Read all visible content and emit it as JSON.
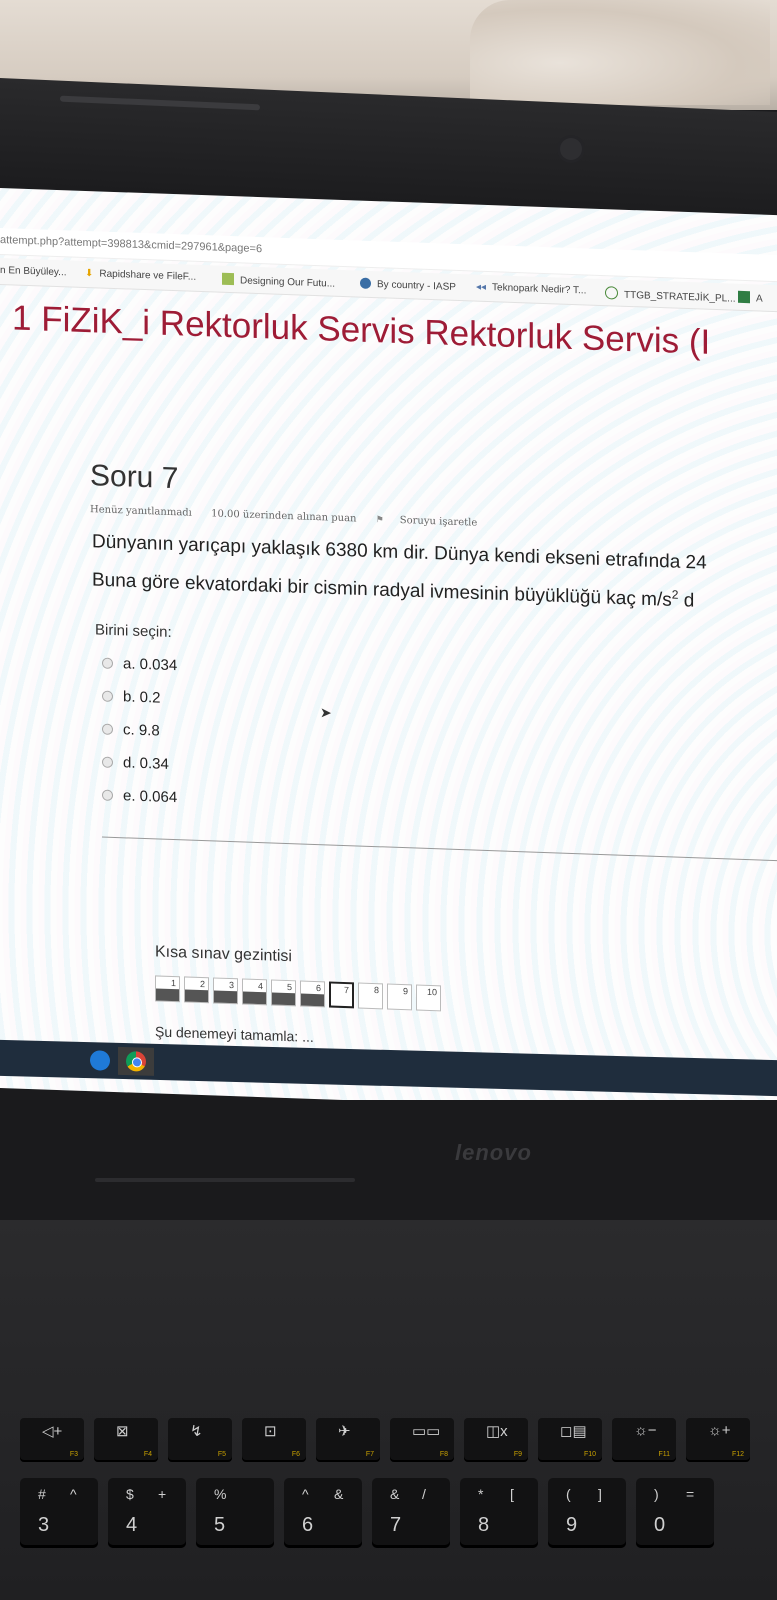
{
  "browser": {
    "url_fragment": "attempt.php?attempt=398813&cmid=297961&page=6",
    "bookmarks": [
      {
        "label": "n En Büyüley...",
        "icon": "none"
      },
      {
        "label": "Rapidshare ve FileF...",
        "icon": "download-icon"
      },
      {
        "label": "Designing Our Futu...",
        "icon": "document-icon"
      },
      {
        "label": "By country - IASP",
        "icon": "globe-icon"
      },
      {
        "label": "Teknopark Nedir? T...",
        "icon": "teknopark-icon"
      },
      {
        "label": "TTGB_STRATEJİK_PL...",
        "icon": "ttgb-icon"
      },
      {
        "label": "A",
        "icon": "green-square-icon"
      }
    ]
  },
  "course": {
    "title": "1 FiZiK_i Rektorluk Servis Rektorluk Servis (I"
  },
  "question": {
    "title": "Soru 7",
    "status": "Henüz yanıtlanmadı",
    "points": "10.00 üzerinden alınan puan",
    "flag_label": "Soruyu işaretle",
    "text_line1": "Dünyanın yarıçapı yaklaşık 6380 km dir. Dünya kendi ekseni etrafında 24",
    "text_line2_pre": "Buna göre ekvatordaki bir cismin radyal ivmesinin büyüklüğü kaç m/s",
    "text_line2_sup": "2",
    "text_line2_post": " d",
    "choose_label": "Birini seçin:",
    "options": [
      "a. 0.034",
      "b. 0.2",
      "c. 9.8",
      "d. 0.34",
      "e. 0.064"
    ]
  },
  "quiz_nav": {
    "title": "Kısa sınav gezintisi",
    "pages": [
      "1",
      "2",
      "3",
      "4",
      "5",
      "6",
      "7",
      "8",
      "9",
      "10"
    ],
    "answered_count": 6,
    "current_page": "7",
    "finish_label": "Şu denemeyi tamamla: ..."
  },
  "taskbar": {
    "apps": [
      "edge-icon",
      "chrome-icon"
    ]
  },
  "laptop": {
    "brand": "lenovo",
    "fn_keys": [
      {
        "top": "◁+",
        "fn": "F3"
      },
      {
        "top": "⊠",
        "fn": "F4"
      },
      {
        "top": "↯",
        "fn": "F5"
      },
      {
        "top": "⊡",
        "fn": "F6"
      },
      {
        "top": "✈",
        "fn": "F7"
      },
      {
        "top": "▭▭",
        "fn": "F8"
      },
      {
        "top": "◫x",
        "fn": "F9"
      },
      {
        "top": "◻▤",
        "fn": "F10"
      },
      {
        "top": "☼−",
        "fn": "F11"
      },
      {
        "top": "☼+",
        "fn": "F12"
      }
    ],
    "num_keys": [
      {
        "shift": "#",
        "alt": "^",
        "main": "3"
      },
      {
        "shift": "$",
        "alt": "+",
        "main": "4"
      },
      {
        "shift": "%",
        "alt": "",
        "main": "5"
      },
      {
        "shift": "^",
        "alt": "&",
        "main": "6"
      },
      {
        "shift": "&",
        "alt": "/",
        "main": "7"
      },
      {
        "shift": "*",
        "alt": "[",
        "main": "8"
      },
      {
        "shift": "(",
        "alt": "]",
        "main": "9"
      },
      {
        "shift": ")",
        "alt": "=",
        "main": "0"
      }
    ]
  }
}
